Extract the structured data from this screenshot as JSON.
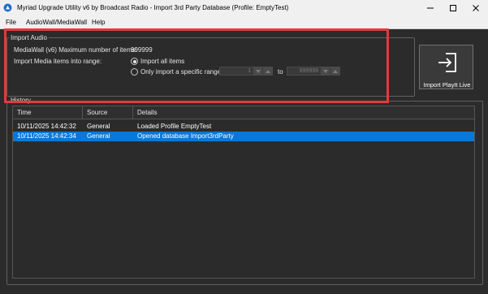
{
  "window": {
    "title": "Myriad Upgrade Utility v6 by Broadcast Radio - Import 3rd Party Database (Profile: EmptyTest)"
  },
  "menu": [
    "File",
    "AudioWall/MediaWall",
    "Help"
  ],
  "import_audio": {
    "group_title": "Import Audio",
    "max_label": "MediaWall (v6) Maximum number of items:",
    "max_value": "999999",
    "range_label": "Import Media items into range:",
    "option_all": "Import all items",
    "option_range": "Only import a specific range:",
    "range_from": "1",
    "range_to_label": "to",
    "range_to": "999999"
  },
  "import_button": {
    "label": "Import PlayIt Live"
  },
  "history": {
    "group_title": "History",
    "columns": [
      "Time",
      "Source",
      "Details"
    ],
    "rows": [
      {
        "time": "10/11/2025 14:42:32",
        "source": "General",
        "details": "Loaded Profile EmptyTest"
      },
      {
        "time": "10/11/2025 14:42:34",
        "source": "General",
        "details": "Opened database Import3rdParty"
      }
    ]
  },
  "colors": {
    "highlight": "#e03c3c",
    "selection": "#0a78d7",
    "background": "#2b2b2b"
  }
}
